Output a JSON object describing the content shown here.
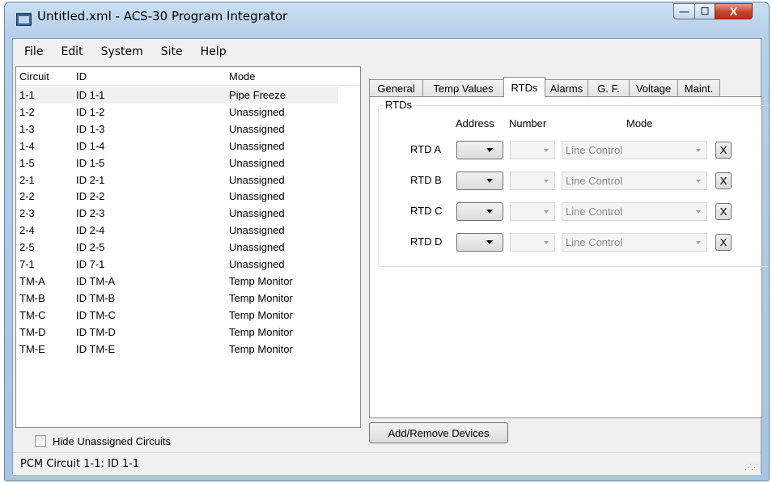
{
  "window": {
    "title": "Untitled.xml - ACS-30 Program Integrator",
    "min_glyph": "—",
    "max_glyph": "☐",
    "close_glyph": "X"
  },
  "menu": [
    "File",
    "Edit",
    "System",
    "Site",
    "Help"
  ],
  "circuit_list": {
    "columns": [
      "Circuit",
      "ID",
      "Mode"
    ],
    "rows": [
      {
        "circuit": "1-1",
        "id": "ID 1-1",
        "mode": "Pipe Freeze"
      },
      {
        "circuit": "1-2",
        "id": "ID 1-2",
        "mode": "Unassigned"
      },
      {
        "circuit": "1-3",
        "id": "ID 1-3",
        "mode": "Unassigned"
      },
      {
        "circuit": "1-4",
        "id": "ID 1-4",
        "mode": "Unassigned"
      },
      {
        "circuit": "1-5",
        "id": "ID 1-5",
        "mode": "Unassigned"
      },
      {
        "circuit": "2-1",
        "id": "ID 2-1",
        "mode": "Unassigned"
      },
      {
        "circuit": "2-2",
        "id": "ID 2-2",
        "mode": "Unassigned"
      },
      {
        "circuit": "2-3",
        "id": "ID 2-3",
        "mode": "Unassigned"
      },
      {
        "circuit": "2-4",
        "id": "ID 2-4",
        "mode": "Unassigned"
      },
      {
        "circuit": "2-5",
        "id": "ID 2-5",
        "mode": "Unassigned"
      },
      {
        "circuit": "7-1",
        "id": "ID 7-1",
        "mode": "Unassigned"
      },
      {
        "circuit": "TM-A",
        "id": "ID TM-A",
        "mode": "Temp Monitor"
      },
      {
        "circuit": "TM-B",
        "id": "ID TM-B",
        "mode": "Temp Monitor"
      },
      {
        "circuit": "TM-C",
        "id": "ID TM-C",
        "mode": "Temp Monitor"
      },
      {
        "circuit": "TM-D",
        "id": "ID TM-D",
        "mode": "Temp Monitor"
      },
      {
        "circuit": "TM-E",
        "id": "ID TM-E",
        "mode": "Temp Monitor"
      }
    ]
  },
  "hide_unassigned": {
    "label": "Hide Unassigned Circuits",
    "checked": false
  },
  "tabs": [
    "General",
    "Temp Values",
    "RTDs",
    "Alarms",
    "G. F.",
    "Voltage",
    "Maint."
  ],
  "active_tab": "RTDs",
  "rtds": {
    "group_title": "RTDs",
    "col_address": "Address",
    "col_number": "Number",
    "col_mode": "Mode",
    "rows": [
      {
        "label": "RTD A",
        "address": "",
        "number": "",
        "mode": "Line Control",
        "remove": "X"
      },
      {
        "label": "RTD B",
        "address": "",
        "number": "",
        "mode": "Line Control",
        "remove": "X"
      },
      {
        "label": "RTD C",
        "address": "",
        "number": "",
        "mode": "Line Control",
        "remove": "X"
      },
      {
        "label": "RTD D",
        "address": "",
        "number": "",
        "mode": "Line Control",
        "remove": "X"
      }
    ]
  },
  "add_remove_button": "Add/Remove Devices",
  "status": "PCM Circuit 1-1: ID 1-1",
  "colors": {
    "selected_row": "#f0f0f0",
    "close_button": "#c3422c",
    "titlebar": "#b6d0ea"
  }
}
